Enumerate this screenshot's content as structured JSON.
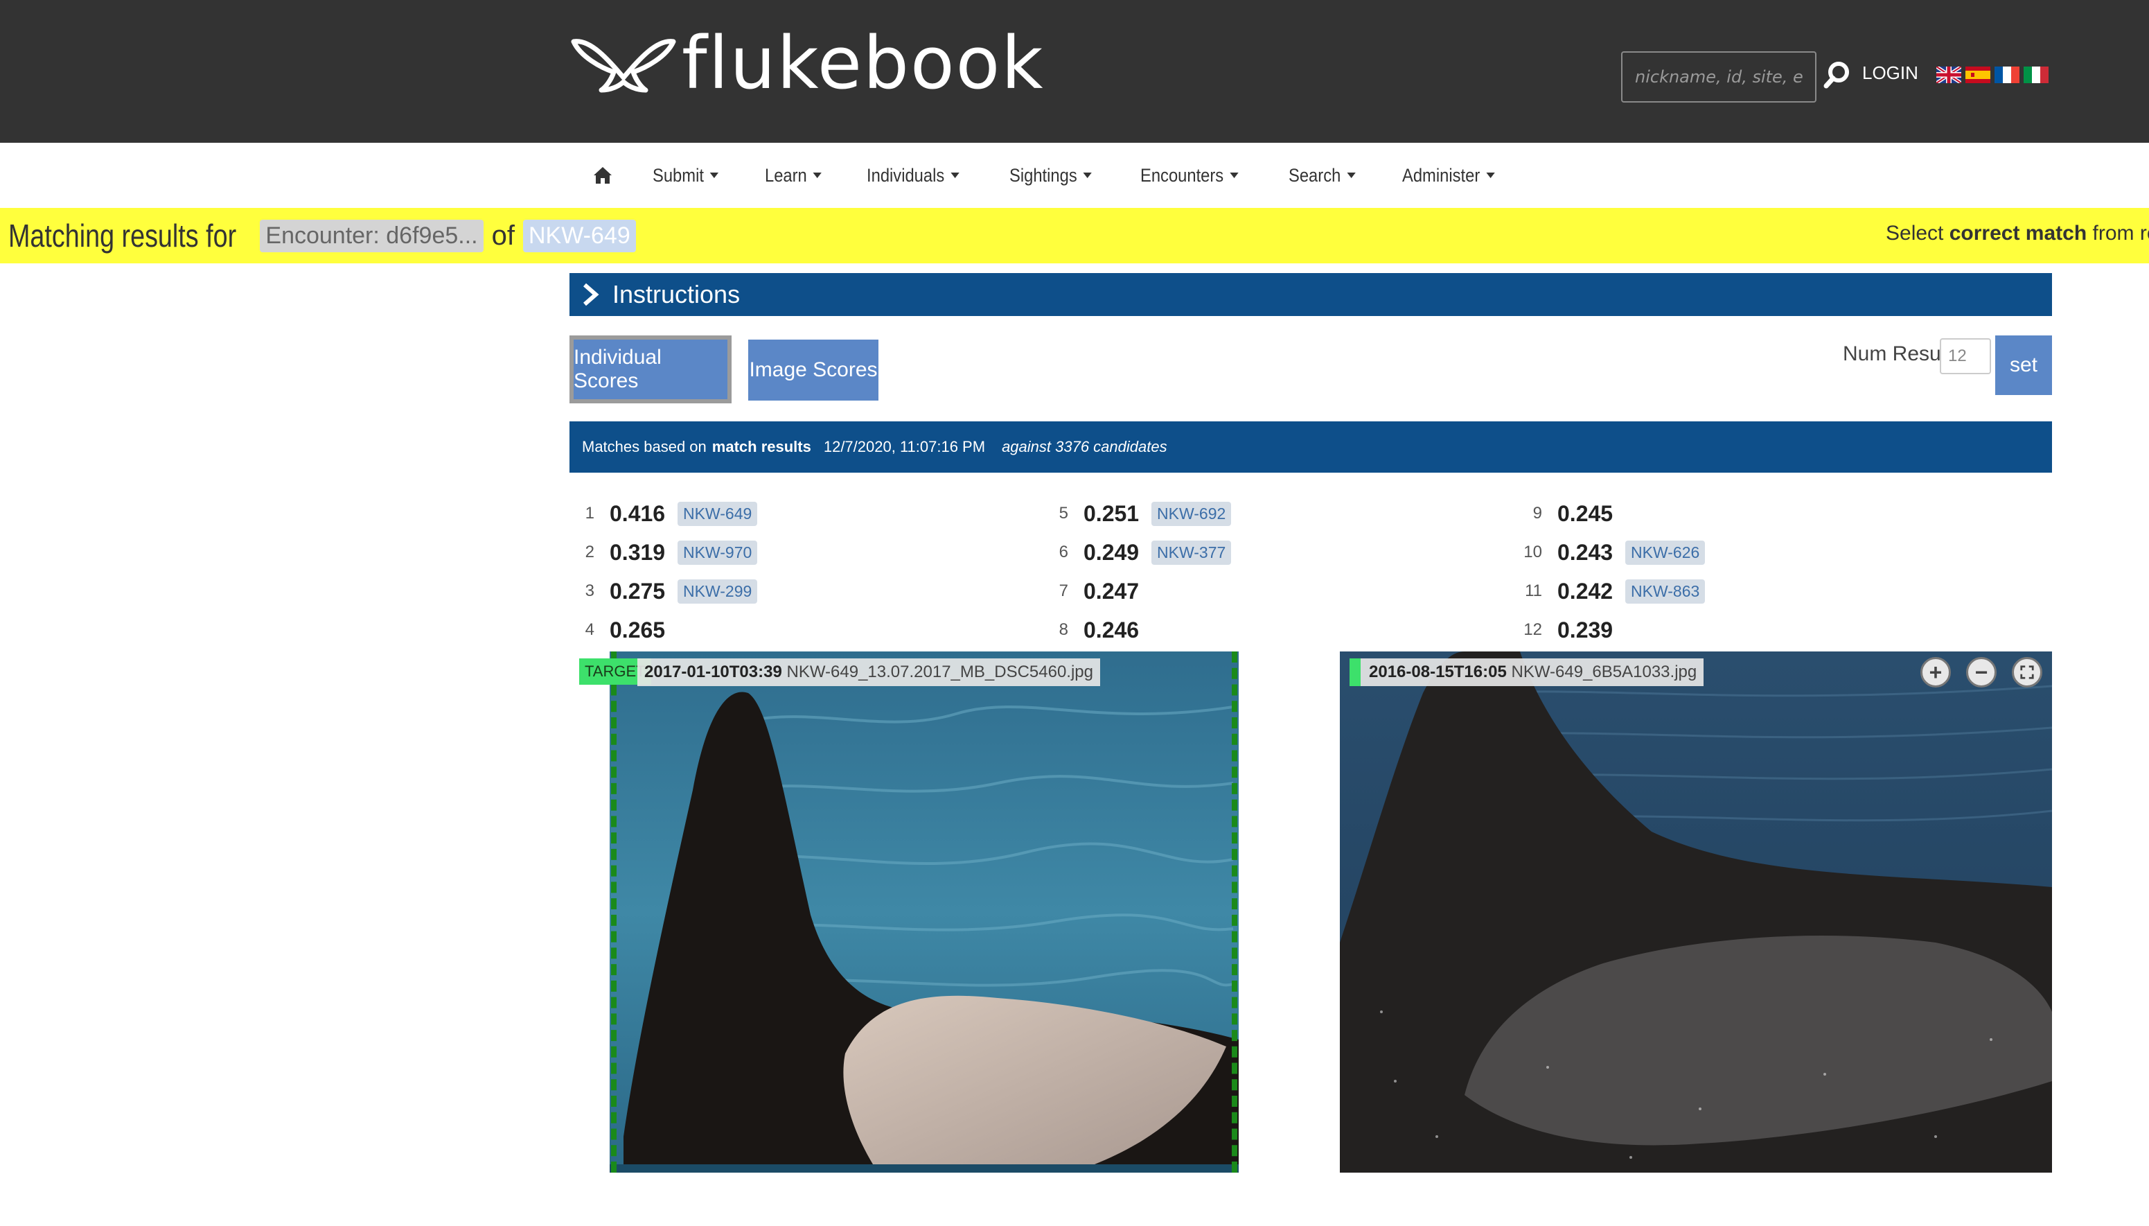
{
  "header": {
    "logo_text": "flukebook",
    "search_placeholder": "nickname, id, site, encounter nu",
    "login_label": "LOGIN",
    "flags": [
      "flag-uk",
      "flag-es",
      "flag-fr",
      "flag-it"
    ]
  },
  "nav": {
    "home_icon": "home-icon",
    "items": [
      {
        "label": "Submit"
      },
      {
        "label": "Learn"
      },
      {
        "label": "Individuals"
      },
      {
        "label": "Sightings"
      },
      {
        "label": "Encounters"
      },
      {
        "label": "Search"
      },
      {
        "label": "Administer"
      }
    ]
  },
  "banner": {
    "prefix": "Matching results for",
    "encounter_chip": "Encounter: d6f9e5...",
    "of": "of",
    "individual_chip": "NKW-649",
    "right_pre": "Select",
    "right_bold": "correct match",
    "right_post": "from result"
  },
  "instructions": {
    "label": "Instructions"
  },
  "buttons": {
    "individual_scores": "Individual Scores",
    "image_scores": "Image Scores",
    "num_results_label": "Num Results:",
    "num_results_value": "12",
    "set_label": "set"
  },
  "matches": {
    "prefix": "Matches based on",
    "bold": "match results",
    "date": "12/7/2020, 11:07:16 PM",
    "candidates": "against 3376 candidates"
  },
  "results": [
    {
      "rank": "1",
      "score": "0.4168",
      "id": "NKW-649"
    },
    {
      "rank": "2",
      "score": "0.3196",
      "id": "NKW-970"
    },
    {
      "rank": "3",
      "score": "0.2758",
      "id": "NKW-299"
    },
    {
      "rank": "4",
      "score": "0.2650",
      "id": ""
    },
    {
      "rank": "5",
      "score": "0.2514",
      "id": "NKW-692"
    },
    {
      "rank": "6",
      "score": "0.2490",
      "id": "NKW-377"
    },
    {
      "rank": "7",
      "score": "0.2475",
      "id": ""
    },
    {
      "rank": "8",
      "score": "0.2468",
      "id": ""
    },
    {
      "rank": "9",
      "score": "0.2453",
      "id": ""
    },
    {
      "rank": "10",
      "score": "0.2437",
      "id": "NKW-626"
    },
    {
      "rank": "11",
      "score": "0.2428",
      "id": "NKW-863"
    },
    {
      "rank": "12",
      "score": "0.2390",
      "id": ""
    }
  ],
  "target_image": {
    "tag": "TARGET",
    "date": "2017-01-10T03:39",
    "filename": "NKW-649_13.07.2017_MB_DSC5460.jpg"
  },
  "candidate_image": {
    "date": "2016-08-15T16:05",
    "filename": "NKW-649_6B5A1033.jpg",
    "controls": [
      "zoom-in-icon",
      "zoom-out-icon",
      "fullscreen-icon"
    ]
  },
  "colors": {
    "header_bg": "#333333",
    "banner_yellow": "#ffff3d",
    "primary_blue": "#0e4f8a",
    "button_blue": "#5b87c7",
    "target_green": "#3de06b"
  }
}
